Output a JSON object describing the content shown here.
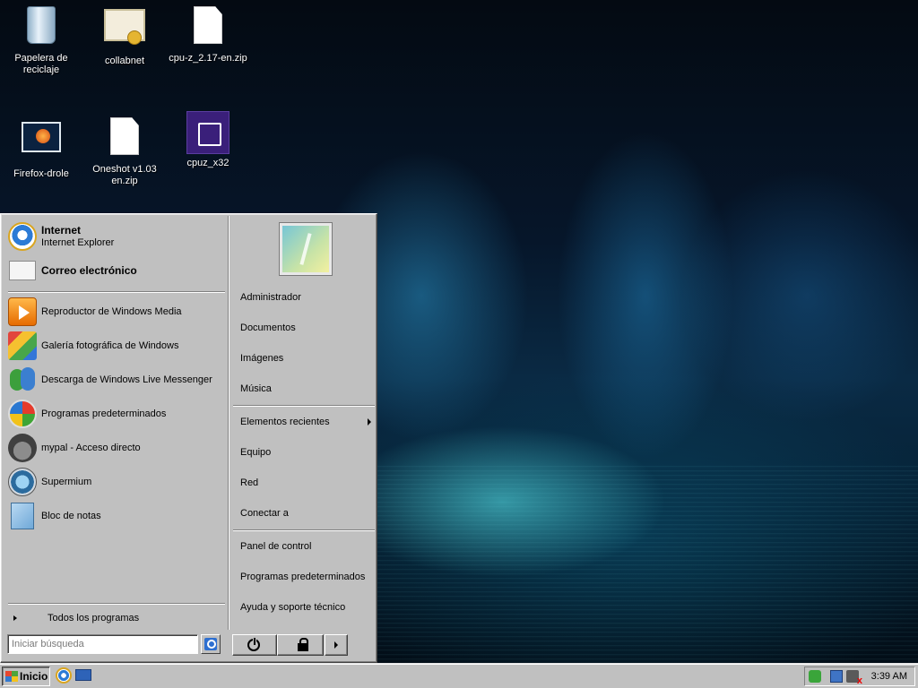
{
  "desktop": {
    "icons": [
      {
        "label": "Papelera de reciclaje",
        "icon": "recycle-bin-icon"
      },
      {
        "label": "collabnet",
        "icon": "certificate-icon"
      },
      {
        "label": "cpu-z_2.17-en.zip",
        "icon": "zip-file-icon"
      },
      {
        "label": "Firefox-drole",
        "icon": "firefox-shortcut-icon"
      },
      {
        "label": "Oneshot v1.03 en.zip",
        "icon": "zip-file-icon"
      },
      {
        "label": "cpuz_x32",
        "icon": "cpu-chip-icon"
      }
    ]
  },
  "start_menu": {
    "pinned": [
      {
        "title": "Internet",
        "subtitle": "Internet Explorer",
        "icon": "internet-explorer-icon"
      },
      {
        "title": "Correo electrónico",
        "icon": "email-icon"
      }
    ],
    "recent": [
      {
        "label": "Reproductor de Windows Media",
        "icon": "media-player-icon"
      },
      {
        "label": "Galería fotográfica de Windows",
        "icon": "photo-gallery-icon"
      },
      {
        "label": "Descarga de Windows Live Messenger",
        "icon": "messenger-icon"
      },
      {
        "label": "Programas predeterminados",
        "icon": "default-programs-icon"
      },
      {
        "label": "mypal - Acceso directo",
        "icon": "mypal-icon"
      },
      {
        "label": "Supermium",
        "icon": "supermium-icon"
      },
      {
        "label": "Bloc de notas",
        "icon": "notepad-icon"
      }
    ],
    "all_programs": "Todos los programas",
    "places": [
      {
        "label": "Administrador"
      },
      {
        "label": "Documentos"
      },
      {
        "label": "Imágenes"
      },
      {
        "label": "Música"
      },
      {
        "label": "Elementos recientes",
        "has_submenu": true
      },
      {
        "label": "Equipo"
      },
      {
        "label": "Red"
      },
      {
        "label": "Conectar a"
      },
      {
        "label": "Panel de control"
      },
      {
        "label": "Programas predeterminados"
      },
      {
        "label": "Ayuda y soporte técnico"
      }
    ],
    "search_placeholder": "Iniciar búsqueda"
  },
  "taskbar": {
    "start_label": "Inicio",
    "clock": "3:39 AM"
  }
}
